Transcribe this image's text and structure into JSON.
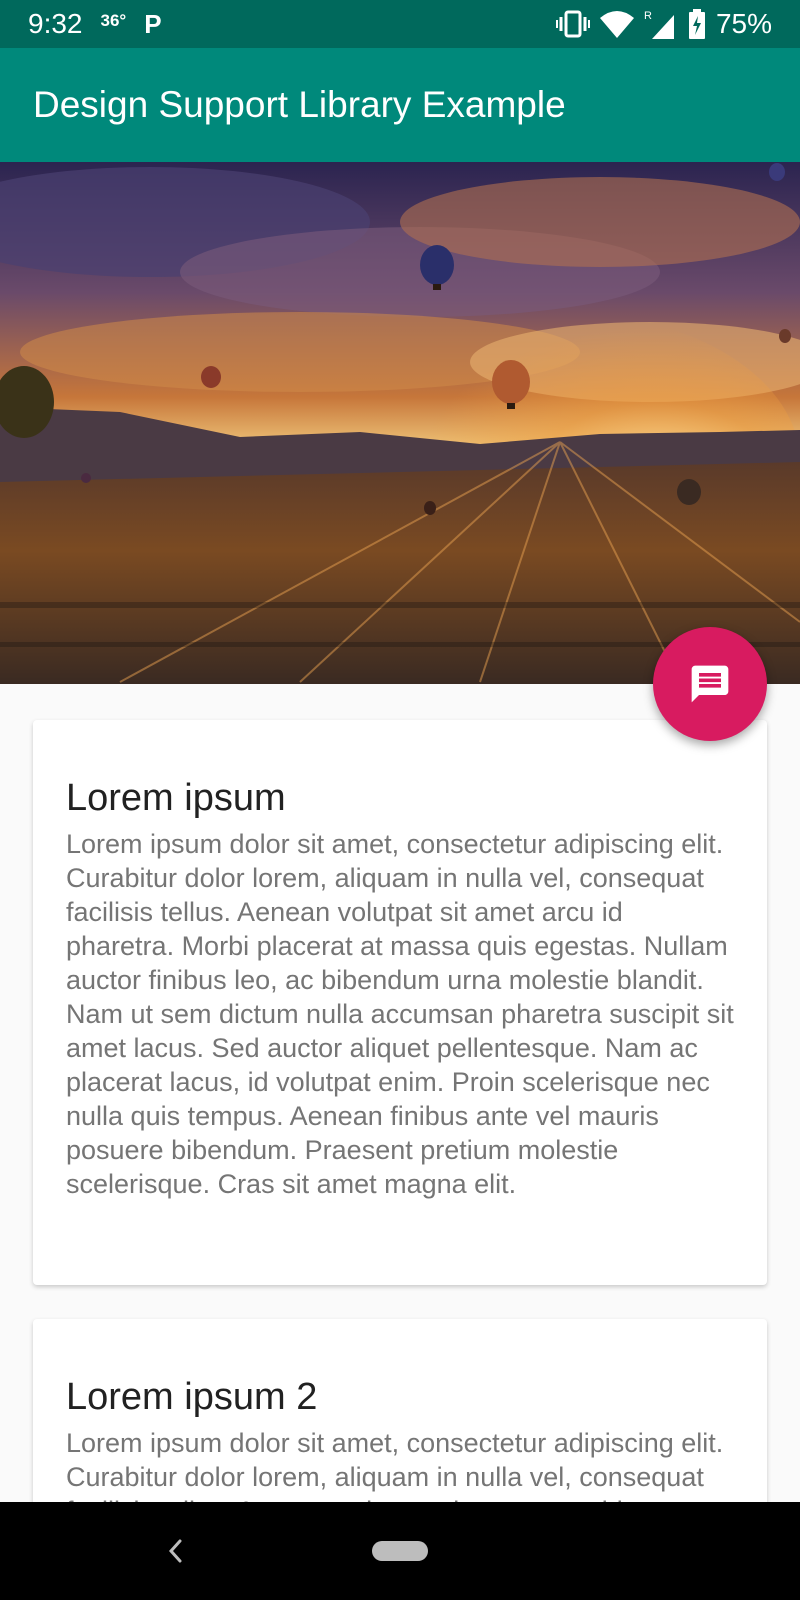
{
  "status_bar": {
    "time": "9:32",
    "temperature": "36°",
    "app_indicator": "P",
    "battery": "75%",
    "icons": [
      "vibrate-icon",
      "wifi-icon",
      "signal-roaming-icon",
      "battery-charging-icon"
    ]
  },
  "app_bar": {
    "title": "Design Support Library Example",
    "color": "#00897b",
    "status_color": "#00695c"
  },
  "header_image": {
    "subject": "hot air balloons over city at sunset"
  },
  "fab": {
    "icon": "message-icon",
    "color": "#d81b60"
  },
  "cards": [
    {
      "title": "Lorem ipsum",
      "body": "Lorem ipsum dolor sit amet, consectetur adipiscing elit. Curabitur dolor lorem, aliquam in nulla vel, consequat facilisis tellus. Aenean volutpat sit amet arcu id pharetra. Morbi placerat at massa quis egestas. Nullam auctor finibus leo, ac bibendum urna molestie blandit. Nam ut sem dictum nulla accumsan pharetra suscipit sit amet lacus. Sed auctor aliquet pellentesque. Nam ac placerat lacus, id volutpat enim. Proin scelerisque nec nulla quis tempus. Aenean finibus ante vel mauris posuere bibendum. Praesent pretium molestie scelerisque. Cras sit amet magna elit."
    },
    {
      "title": "Lorem ipsum 2",
      "body": "Lorem ipsum dolor sit amet, consectetur adipiscing elit. Curabitur dolor lorem, aliquam in nulla vel, consequat facilisis tellus. Aenean volutpat sit amet arcu id pharetra."
    }
  ],
  "nav_bar": {
    "icons": [
      "back-icon",
      "home-pill-icon"
    ]
  }
}
